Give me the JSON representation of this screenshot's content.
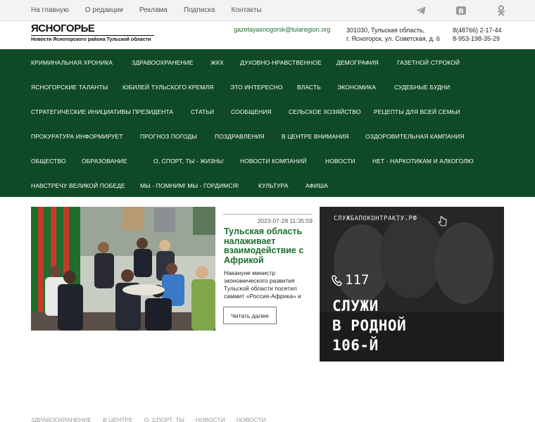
{
  "topbar": {
    "links": [
      "На главную",
      "О редакции",
      "Реклама",
      "Подписка",
      "Контакты"
    ],
    "social": [
      "telegram-icon",
      "vk-icon",
      "odnoklassniki-icon"
    ]
  },
  "header": {
    "logo": "ЯСНОГОРЬЕ",
    "tagline": "Новости Ясногорского района Тульской области",
    "email": "gazetayasnogorsk@tularegion.org",
    "address_line1": "301030, Тульская область,",
    "address_line2": "г. Ясногорск, ул. Советская, д. 6",
    "phone1": "8(48766) 2-17-44",
    "phone2": "8-953-198-35-29"
  },
  "nav": {
    "rows": [
      [
        "КРИМИНАЛЬНАЯ ХРОНИКА",
        "ЗДРАВООХРАНЕНИЕ",
        "ЖКХ",
        "ДУХОВНО-НРАВСТВЕННОЕ",
        "ДЕМОГРАФИЯ",
        "ГАЗЕТНОЙ СТРОКОЙ"
      ],
      [
        "ЯСНОГОРСКИЕ ТАЛАНТЫ",
        "ЮБИЛЕЙ ТУЛЬСКОГО КРЕМЛЯ",
        "ЭТО ИНТЕРЕСНО",
        "ВЛАСТЬ",
        "ЭКОНОМИКА",
        "СУДЕБНЫЕ БУДНИ"
      ],
      [
        "СТРАТЕГИЧЕСКИЕ ИНИЦИАТИВЫ ПРЕЗИДЕНТА",
        "СТАТЬИ",
        "СООБЩЕНИЯ",
        "СЕЛЬСКОЕ ХОЗЯЙСТВО",
        "РЕЦЕПТЫ ДЛЯ ВСЕЙ СЕМЬИ"
      ],
      [
        "ПРОКУРАТУРА ИНФОРМИРУЕТ",
        "ПРОГНОЗ ПОГОДЫ",
        "ПОЗДРАВЛЕНИЯ",
        "В ЦЕНТРЕ ВНИМАНИЯ",
        "ОЗДОРОВИТЕЛЬНАЯ КАМПАНИЯ"
      ],
      [
        "ОБЩЕСТВО",
        "ОБРАЗОВАНИЕ",
        "О, СПОРТ, ТЫ - ЖИЗНЬ!",
        "НОВОСТИ КОМПАНИЙ",
        "НОВОСТИ",
        "НЕТ - НАРКОТИКАМ И АЛКОГОЛЮ"
      ],
      [
        "НАВСТРЕЧУ ВЕЛИКОЙ ПОБЕДЕ",
        "МЫ - ПОМНИМ! МЫ - ГОРДИМСЯ!",
        "КУЛЬТУРА",
        "АФИША"
      ]
    ]
  },
  "news": {
    "date": "2023-07-28 11:35:59",
    "title": "Тульская область налаживает взаимодействие с Африкой",
    "lead": "Накануне министр экономического развития Тульской области посетил саммит «Россия-Африка» и",
    "read_more": "Читать далее"
  },
  "banner": {
    "site": "СЛУЖБАПОКОНТРАКТУ.РФ",
    "phone": "117",
    "slogan": "СЛУЖИ\nВ РОДНОЙ\n106-Й"
  },
  "bottom": [
    "ЗДРАВООХРАНЕНИЕ",
    "В ЦЕНТРЕ",
    "О, СПОРТ, ТЫ",
    "НОВОСТИ",
    "НОВОСТИ"
  ],
  "colors": {
    "nav_bg": "#0f4a26",
    "accent": "#1a6e2c"
  }
}
